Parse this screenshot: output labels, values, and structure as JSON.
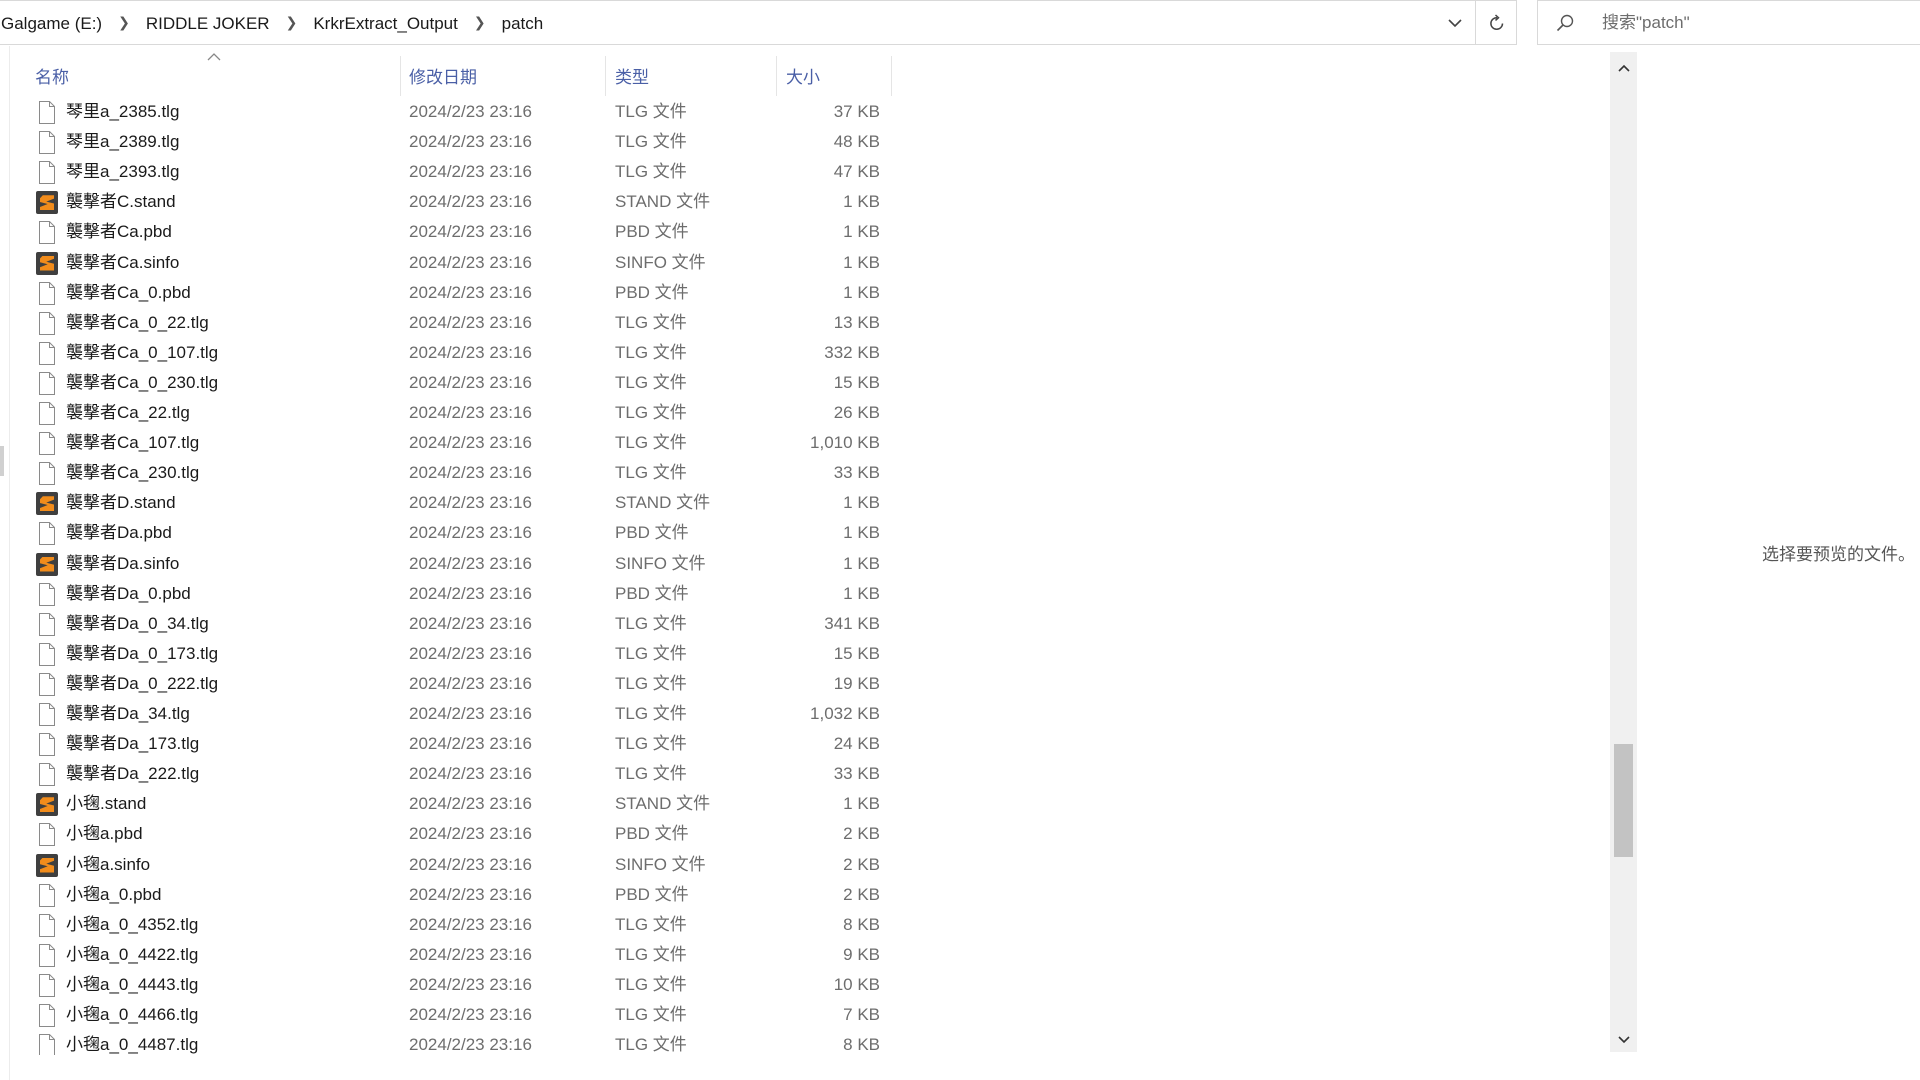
{
  "breadcrumb": [
    "Galgame (E:)",
    "RIDDLE JOKER",
    "KrkrExtract_Output",
    "patch"
  ],
  "search": {
    "placeholder": "搜索\"patch\""
  },
  "columns": {
    "name": "名称",
    "date": "修改日期",
    "type": "类型",
    "size": "大小"
  },
  "files": [
    {
      "name": "琴里a_2385.tlg",
      "date": "2024/2/23 23:16",
      "type": "TLG 文件",
      "size": "37 KB",
      "icon": "blank-file-icon"
    },
    {
      "name": "琴里a_2389.tlg",
      "date": "2024/2/23 23:16",
      "type": "TLG 文件",
      "size": "48 KB",
      "icon": "blank-file-icon"
    },
    {
      "name": "琴里a_2393.tlg",
      "date": "2024/2/23 23:16",
      "type": "TLG 文件",
      "size": "47 KB",
      "icon": "blank-file-icon"
    },
    {
      "name": "襲撃者C.stand",
      "date": "2024/2/23 23:16",
      "type": "STAND 文件",
      "size": "1 KB",
      "icon": "sublime-file-icon"
    },
    {
      "name": "襲撃者Ca.pbd",
      "date": "2024/2/23 23:16",
      "type": "PBD 文件",
      "size": "1 KB",
      "icon": "blank-file-icon"
    },
    {
      "name": "襲撃者Ca.sinfo",
      "date": "2024/2/23 23:16",
      "type": "SINFO 文件",
      "size": "1 KB",
      "icon": "sublime-file-icon"
    },
    {
      "name": "襲撃者Ca_0.pbd",
      "date": "2024/2/23 23:16",
      "type": "PBD 文件",
      "size": "1 KB",
      "icon": "blank-file-icon"
    },
    {
      "name": "襲撃者Ca_0_22.tlg",
      "date": "2024/2/23 23:16",
      "type": "TLG 文件",
      "size": "13 KB",
      "icon": "blank-file-icon"
    },
    {
      "name": "襲撃者Ca_0_107.tlg",
      "date": "2024/2/23 23:16",
      "type": "TLG 文件",
      "size": "332 KB",
      "icon": "blank-file-icon"
    },
    {
      "name": "襲撃者Ca_0_230.tlg",
      "date": "2024/2/23 23:16",
      "type": "TLG 文件",
      "size": "15 KB",
      "icon": "blank-file-icon"
    },
    {
      "name": "襲撃者Ca_22.tlg",
      "date": "2024/2/23 23:16",
      "type": "TLG 文件",
      "size": "26 KB",
      "icon": "blank-file-icon"
    },
    {
      "name": "襲撃者Ca_107.tlg",
      "date": "2024/2/23 23:16",
      "type": "TLG 文件",
      "size": "1,010 KB",
      "icon": "blank-file-icon"
    },
    {
      "name": "襲撃者Ca_230.tlg",
      "date": "2024/2/23 23:16",
      "type": "TLG 文件",
      "size": "33 KB",
      "icon": "blank-file-icon"
    },
    {
      "name": "襲撃者D.stand",
      "date": "2024/2/23 23:16",
      "type": "STAND 文件",
      "size": "1 KB",
      "icon": "sublime-file-icon"
    },
    {
      "name": "襲撃者Da.pbd",
      "date": "2024/2/23 23:16",
      "type": "PBD 文件",
      "size": "1 KB",
      "icon": "blank-file-icon"
    },
    {
      "name": "襲撃者Da.sinfo",
      "date": "2024/2/23 23:16",
      "type": "SINFO 文件",
      "size": "1 KB",
      "icon": "sublime-file-icon"
    },
    {
      "name": "襲撃者Da_0.pbd",
      "date": "2024/2/23 23:16",
      "type": "PBD 文件",
      "size": "1 KB",
      "icon": "blank-file-icon"
    },
    {
      "name": "襲撃者Da_0_34.tlg",
      "date": "2024/2/23 23:16",
      "type": "TLG 文件",
      "size": "341 KB",
      "icon": "blank-file-icon"
    },
    {
      "name": "襲撃者Da_0_173.tlg",
      "date": "2024/2/23 23:16",
      "type": "TLG 文件",
      "size": "15 KB",
      "icon": "blank-file-icon"
    },
    {
      "name": "襲撃者Da_0_222.tlg",
      "date": "2024/2/23 23:16",
      "type": "TLG 文件",
      "size": "19 KB",
      "icon": "blank-file-icon"
    },
    {
      "name": "襲撃者Da_34.tlg",
      "date": "2024/2/23 23:16",
      "type": "TLG 文件",
      "size": "1,032 KB",
      "icon": "blank-file-icon"
    },
    {
      "name": "襲撃者Da_173.tlg",
      "date": "2024/2/23 23:16",
      "type": "TLG 文件",
      "size": "24 KB",
      "icon": "blank-file-icon"
    },
    {
      "name": "襲撃者Da_222.tlg",
      "date": "2024/2/23 23:16",
      "type": "TLG 文件",
      "size": "33 KB",
      "icon": "blank-file-icon"
    },
    {
      "name": "小毱.stand",
      "date": "2024/2/23 23:16",
      "type": "STAND 文件",
      "size": "1 KB",
      "icon": "sublime-file-icon"
    },
    {
      "name": "小毱a.pbd",
      "date": "2024/2/23 23:16",
      "type": "PBD 文件",
      "size": "2 KB",
      "icon": "blank-file-icon"
    },
    {
      "name": "小毱a.sinfo",
      "date": "2024/2/23 23:16",
      "type": "SINFO 文件",
      "size": "2 KB",
      "icon": "sublime-file-icon"
    },
    {
      "name": "小毱a_0.pbd",
      "date": "2024/2/23 23:16",
      "type": "PBD 文件",
      "size": "2 KB",
      "icon": "blank-file-icon"
    },
    {
      "name": "小毱a_0_4352.tlg",
      "date": "2024/2/23 23:16",
      "type": "TLG 文件",
      "size": "8 KB",
      "icon": "blank-file-icon"
    },
    {
      "name": "小毱a_0_4422.tlg",
      "date": "2024/2/23 23:16",
      "type": "TLG 文件",
      "size": "9 KB",
      "icon": "blank-file-icon"
    },
    {
      "name": "小毱a_0_4443.tlg",
      "date": "2024/2/23 23:16",
      "type": "TLG 文件",
      "size": "10 KB",
      "icon": "blank-file-icon"
    },
    {
      "name": "小毱a_0_4466.tlg",
      "date": "2024/2/23 23:16",
      "type": "TLG 文件",
      "size": "7 KB",
      "icon": "blank-file-icon"
    },
    {
      "name": "小毱a_0_4487.tlg",
      "date": "2024/2/23 23:16",
      "type": "TLG 文件",
      "size": "8 KB",
      "icon": "blank-file-icon"
    }
  ],
  "scrollbar": {
    "position": 0.8,
    "visible_fraction": 0.12
  },
  "preview": {
    "message": "选择要预览的文件。"
  },
  "colors": {
    "header_text": "#4a5fa6",
    "secondary_text": "#6d6d6d",
    "sublime_orange": "#f28c1b",
    "sublime_dark": "#3f3f3f"
  }
}
